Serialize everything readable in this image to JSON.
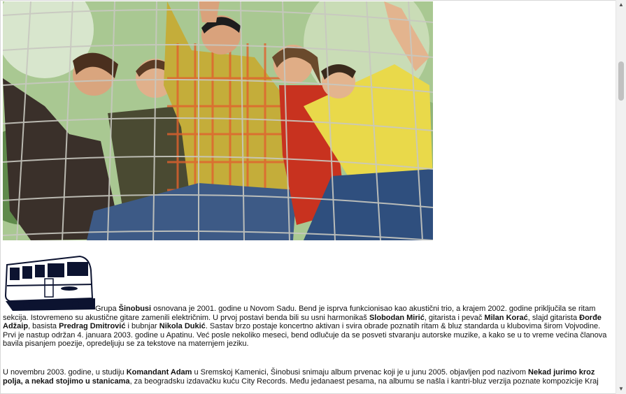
{
  "paragraphs": {
    "p1": [
      {
        "t": "Grupa ",
        "b": false
      },
      {
        "t": "Šinobusi",
        "b": true
      },
      {
        "t": " osnovana je 2001. godine u Novom Sadu. Bend je isprva funkcionisao kao akustični trio, a krajem 2002. godine priključila se ritam sekcija. Istovremeno su akustične gitare zamenili električnim. U prvoj postavi benda bili su usni harmonikaš ",
        "b": false
      },
      {
        "t": "Slobodan Mirić",
        "b": true
      },
      {
        "t": ", gitarista i pevač ",
        "b": false
      },
      {
        "t": "Milan Korać",
        "b": true
      },
      {
        "t": ", slajd gitarista ",
        "b": false
      },
      {
        "t": "Đorđe Adžaip",
        "b": true
      },
      {
        "t": ", basista ",
        "b": false
      },
      {
        "t": "Predrag Dmitrović",
        "b": true
      },
      {
        "t": " i bubnjar ",
        "b": false
      },
      {
        "t": "Nikola Dukić",
        "b": true
      },
      {
        "t": ". Sastav brzo postaje koncertno aktivan i svira obrade poznatih ritam & bluz standarda u klubovima širom Vojvodine. Prvi je nastup održan 4. januara 2003. godine u Apatinu. Već posle nekoliko meseci, bend odlučuje da se posveti stvaranju autorske muzike, a kako se u to vreme većina članova bavila pisanjem poezije, opredeljuju se za tekstove na maternjem jeziku.",
        "b": false
      }
    ],
    "p2": [
      {
        "t": "U novembru 2003. godine, u studiju ",
        "b": false
      },
      {
        "t": "Komandant Adam",
        "b": true
      },
      {
        "t": " u Sremskoj Kamenici, Šinobusi snimaju album prvenac koji je u junu 2005. objavljen pod nazivom ",
        "b": false
      },
      {
        "t": "Nekad jurimo kroz polja, a nekad stojimo u stanicama",
        "b": true
      },
      {
        "t": ", za beogradsku izdavačku kuću City Records. Među jedanaest pesama, na albumu se našla i kantri-bluz verzija poznate kompozicije Kraj",
        "b": false
      }
    ]
  },
  "scrollbar": {
    "up": "▲",
    "down": "▼"
  }
}
